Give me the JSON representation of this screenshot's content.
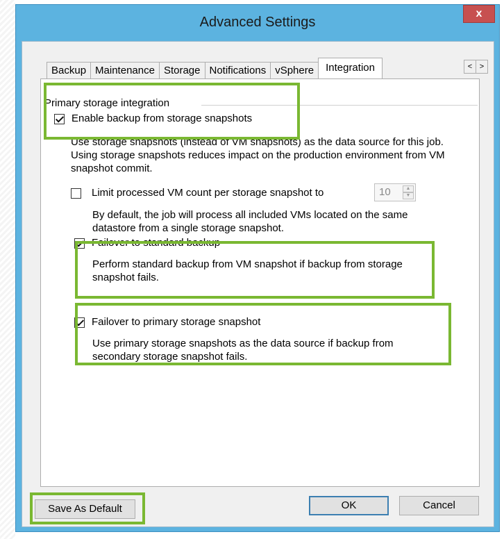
{
  "window": {
    "title": "Advanced Settings",
    "close_label": "x"
  },
  "tabs": [
    {
      "label": "Backup"
    },
    {
      "label": "Maintenance"
    },
    {
      "label": "Storage"
    },
    {
      "label": "Notifications"
    },
    {
      "label": "vSphere"
    },
    {
      "label": "Integration",
      "active": true
    }
  ],
  "tab_scroll": {
    "left": "<",
    "right": ">"
  },
  "group": {
    "title": "Primary storage integration"
  },
  "enable_backup": {
    "checked": true,
    "label": "Enable backup from storage snapshots",
    "description": "Use storage snapshots (instead of VM snapshots) as the data source for this job. Using storage snapshots reduces impact on the production environment from VM snapshot commit."
  },
  "limit_vm": {
    "checked": false,
    "label": "Limit processed VM count per storage snapshot to",
    "value": "10",
    "description": "By default, the job will process all included VMs located on the same datastore from a single storage snapshot."
  },
  "failover_standard": {
    "checked": true,
    "label": "Failover to standard backup",
    "description": "Perform standard backup from VM snapshot if backup from storage snapshot fails."
  },
  "failover_primary": {
    "checked": true,
    "label": "Failover to primary storage snapshot",
    "description": "Use primary storage snapshots as the data source if backup from secondary storage snapshot fails."
  },
  "buttons": {
    "save_default": "Save As Default",
    "ok": "OK",
    "cancel": "Cancel"
  },
  "colors": {
    "highlight": "#7ab832",
    "titlebar": "#5cb3e0",
    "close": "#c75050"
  }
}
